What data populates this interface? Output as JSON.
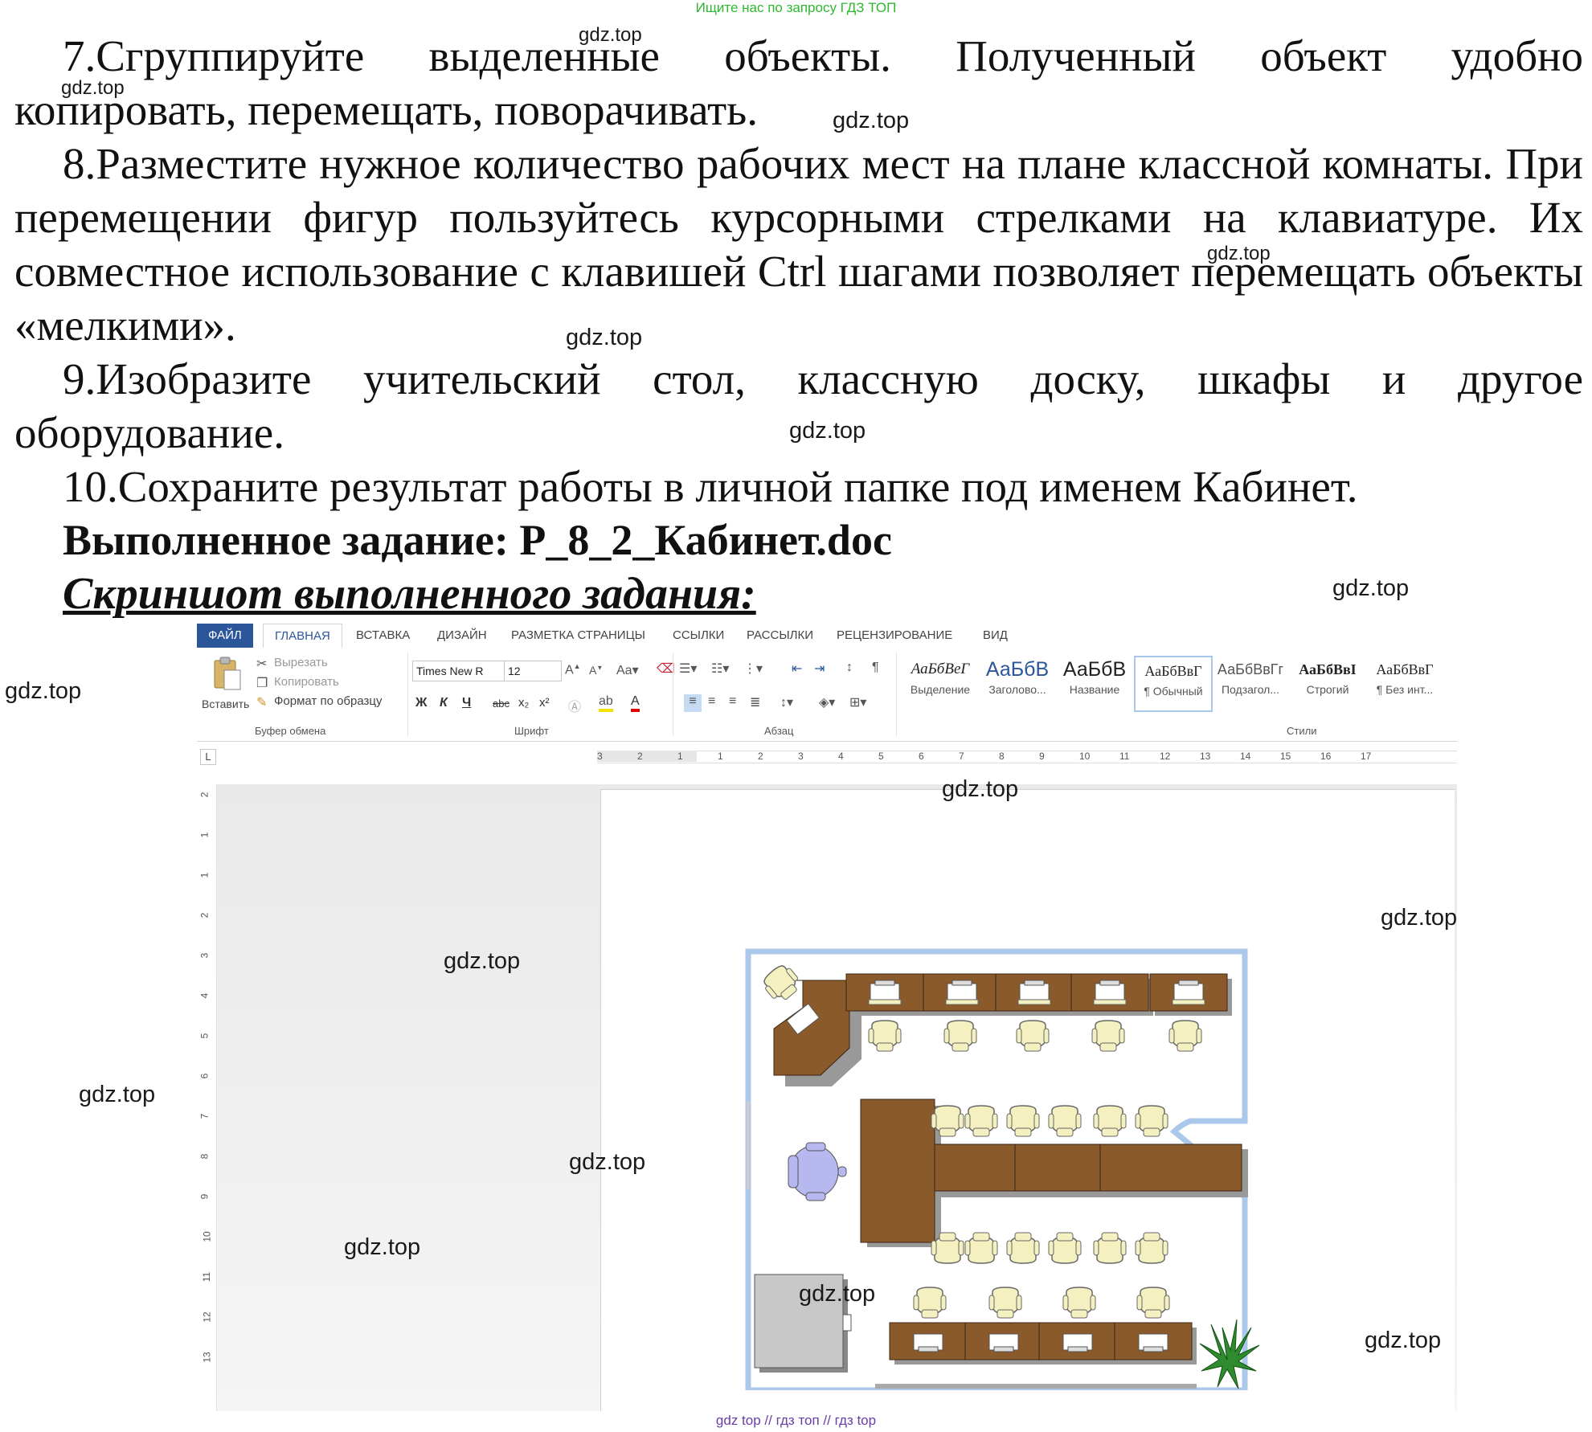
{
  "banner_top": "Ищите нас по запросу ГДЗ ТОП",
  "banner_bottom": "gdz top  //  гдз топ  //  гдз top",
  "watermark": "gdz.top",
  "doc": {
    "p7_line1": "7.Сгруппируйте выделенные объекты. Полученный объект удобно",
    "p7_line2": "копировать, перемещать, поворачивать.",
    "p8": "8.Разместите нужное количество рабочих мест на плане классной комнаты. При перемещении фигур пользуйтесь курсорными стрелками на клавиатуре. Их совместное использование с клавишей Ctrl шагами позволяет перемещать объекты «мелкими».",
    "p9_line1": "9.Изобразите учительский стол, классную доску, шкафы и другое",
    "p9_line2": "оборудование.",
    "p10": "10.Сохраните результат работы в личной папке под именем Кабинет.",
    "done_label": "Выполненное задание: Р_8_2_Кабинет.doc",
    "screenshot_label": "Скриншот выполненного задания:"
  },
  "word": {
    "tabs": [
      "ФАЙЛ",
      "ГЛАВНАЯ",
      "ВСТАВКА",
      "ДИЗАЙН",
      "РАЗМЕТКА СТРАНИЦЫ",
      "ССЫЛКИ",
      "РАССЫЛКИ",
      "РЕЦЕНЗИРОВАНИЕ",
      "ВИД"
    ],
    "clipboard": {
      "paste": "Вставить",
      "cut": "Вырезать",
      "copy": "Копировать",
      "format_painter": "Формат по образцу",
      "group": "Буфер обмена"
    },
    "font": {
      "name": "Times New R",
      "size": "12",
      "group": "Шрифт",
      "bold": "Ж",
      "italic": "К",
      "underline": "Ч",
      "strike": "abc",
      "sub": "x₂",
      "sup": "x²"
    },
    "paragraph": {
      "group": "Абзац"
    },
    "styles": {
      "group": "Стили",
      "items": [
        {
          "sample": "АаБбВеГ",
          "label": "Выделение"
        },
        {
          "sample": "АаБбВ",
          "label": "Заголово..."
        },
        {
          "sample": "АаБбВ",
          "label": "Название"
        },
        {
          "sample": "АаБбВвГ",
          "label": "¶ Обычный"
        },
        {
          "sample": "АаБбВвГг",
          "label": "Подзагол..."
        },
        {
          "sample": "АаБбВвІ",
          "label": "Строгий"
        },
        {
          "sample": "АаБбВвГ",
          "label": "¶ Без инт..."
        }
      ]
    },
    "ruler_h": [
      "3",
      "2",
      "1",
      "1",
      "2",
      "3",
      "4",
      "5",
      "6",
      "7",
      "8",
      "9",
      "10",
      "11",
      "12",
      "13",
      "14",
      "15",
      "16",
      "17"
    ],
    "ruler_v": [
      "2",
      "1",
      "1",
      "2",
      "3",
      "4",
      "5",
      "6",
      "7",
      "8",
      "9",
      "10",
      "11",
      "12",
      "13"
    ],
    "ruler_corner": "L"
  },
  "colors": {
    "desk": "#8b5a2b",
    "chair": "#f4f0c0",
    "teacher_chair": "#b8b8f0",
    "wall": "#a9c8ea",
    "plant": "#2e8b2e",
    "word_blue": "#2b579a"
  }
}
